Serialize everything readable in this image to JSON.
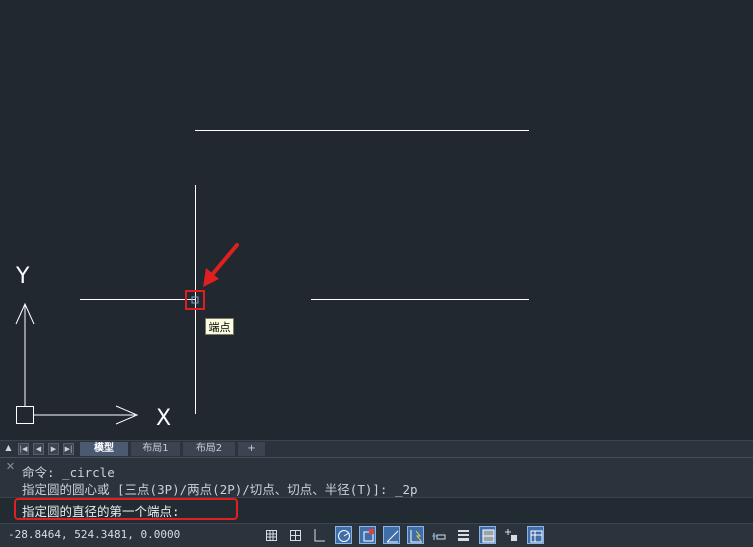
{
  "canvas": {
    "tooltip": "端点",
    "axis_x_label": "X",
    "axis_y_label": "Y",
    "background_color": "#212830",
    "highlight_color": "#e02020"
  },
  "layout_tabs": {
    "nav_icons": [
      "triangle-up-icon",
      "first-icon",
      "prev-icon",
      "next-icon",
      "last-icon"
    ],
    "tabs": [
      {
        "label": "模型",
        "active": true
      },
      {
        "label": "布局1",
        "active": false
      },
      {
        "label": "布局2",
        "active": false
      },
      {
        "label": "+",
        "active": false
      }
    ]
  },
  "command": {
    "history": [
      "命令: _circle",
      "指定圆的圆心或 [三点(3P)/两点(2P)/切点、切点、半径(T)]: _2p"
    ],
    "prompt": "指定圆的直径的第一个端点:"
  },
  "status_bar": {
    "coordinates": "-28.8464, 524.3481, 0.0000",
    "buttons": [
      {
        "name": "grid-display-icon",
        "on": false
      },
      {
        "name": "snap-mode-icon",
        "on": false
      },
      {
        "name": "ortho-mode-icon",
        "on": false
      },
      {
        "name": "polar-tracking-icon",
        "on": true
      },
      {
        "name": "object-snap-icon",
        "on": true
      },
      {
        "name": "object-snap-tracking-icon",
        "on": true
      },
      {
        "name": "dynamic-ucs-icon",
        "on": true
      },
      {
        "name": "dynamic-input-icon",
        "on": false
      },
      {
        "name": "lineweight-icon",
        "on": false
      },
      {
        "name": "transparency-icon",
        "on": true
      },
      {
        "name": "selection-cycling-icon",
        "on": false
      },
      {
        "name": "annotation-monitor-icon",
        "on": true
      }
    ]
  }
}
